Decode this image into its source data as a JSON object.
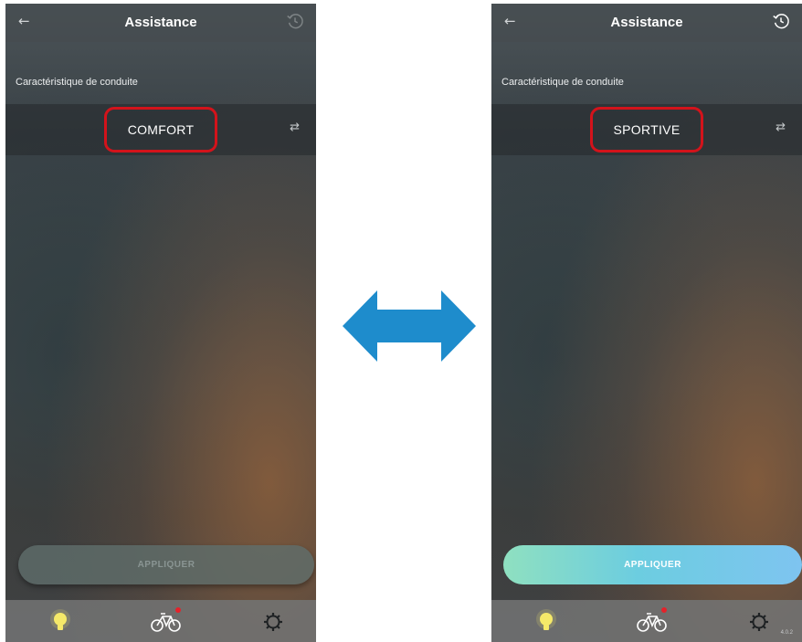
{
  "colors": {
    "highlight": "#d3131b",
    "double_arrow": "#1e8ccc",
    "apply_gradient_start": "#8fe0c0",
    "apply_gradient_end": "#7ec4f0",
    "notification_dot": "#e5222a",
    "bulb_active": "#f6e96a"
  },
  "left_screen": {
    "title": "Assistance",
    "section_label": "Caractéristique de conduite",
    "mode_value": "COMFORT",
    "apply_label": "APPLIQUER",
    "apply_enabled": false,
    "version": "",
    "icons": [
      "back-arrow-icon",
      "history-icon",
      "swap-icon",
      "light-bulb-icon",
      "bike-icon",
      "gear-icon"
    ]
  },
  "right_screen": {
    "title": "Assistance",
    "section_label": "Caractéristique de conduite",
    "mode_value": "SPORTIVE",
    "apply_label": "APPLIQUER",
    "apply_enabled": true,
    "version": "4.0.2",
    "icons": [
      "back-arrow-icon",
      "history-icon",
      "swap-icon",
      "light-bulb-icon",
      "bike-icon",
      "gear-icon"
    ]
  },
  "connector": {
    "icon": "double-arrow-icon"
  }
}
